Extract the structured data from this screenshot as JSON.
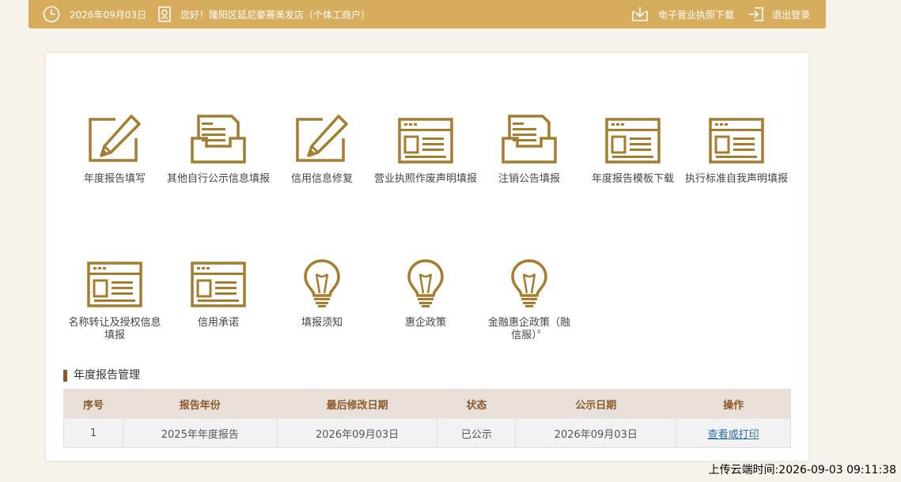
{
  "header": {
    "date": "2026年09月03日",
    "greeting": "您好！隆阳区延尼豪赛美发店（个体工商户）",
    "license_download": "电子营业执照下载",
    "logout": "退出登录"
  },
  "tiles_row1": [
    {
      "label": "年度报告填写",
      "icon": "edit-form-icon"
    },
    {
      "label": "其他自行公示信息填报",
      "icon": "document-tray-icon"
    },
    {
      "label": "信用信息修复",
      "icon": "edit-form-icon"
    },
    {
      "label": "营业执照作废声明填报",
      "icon": "browser-form-icon"
    },
    {
      "label": "注销公告填报",
      "icon": "document-tray-icon"
    },
    {
      "label": "年度报告模板下载",
      "icon": "browser-form-icon"
    },
    {
      "label": "执行标准自我声明填报",
      "icon": "browser-form-icon"
    }
  ],
  "tiles_row2": [
    {
      "label": "名称转让及授权信息填报",
      "icon": "browser-form-icon"
    },
    {
      "label": "信用承诺",
      "icon": "browser-form-icon"
    },
    {
      "label": "填报须知",
      "icon": "lightbulb-icon"
    },
    {
      "label": "惠企政策",
      "icon": "lightbulb-icon"
    },
    {
      "label": "金融惠企政策（融信服）〞",
      "icon": "lightbulb-icon"
    }
  ],
  "annual_report": {
    "title": "年度报告管理",
    "columns": [
      "序号",
      "报告年份",
      "最后修改日期",
      "状态",
      "公示日期",
      "操作"
    ],
    "rows": [
      [
        "1",
        "2025年年度报告",
        "2026年09月03日",
        "已公示",
        "2026年09月03日",
        "查看或打印"
      ]
    ]
  },
  "footer": {
    "upload_time": "上传云端时间:2026-09-03 09:11:38"
  },
  "colors": {
    "accent": "#d6ad5c",
    "icon_brown": "#a67c2e",
    "title_bar": "#8b5a2b"
  }
}
